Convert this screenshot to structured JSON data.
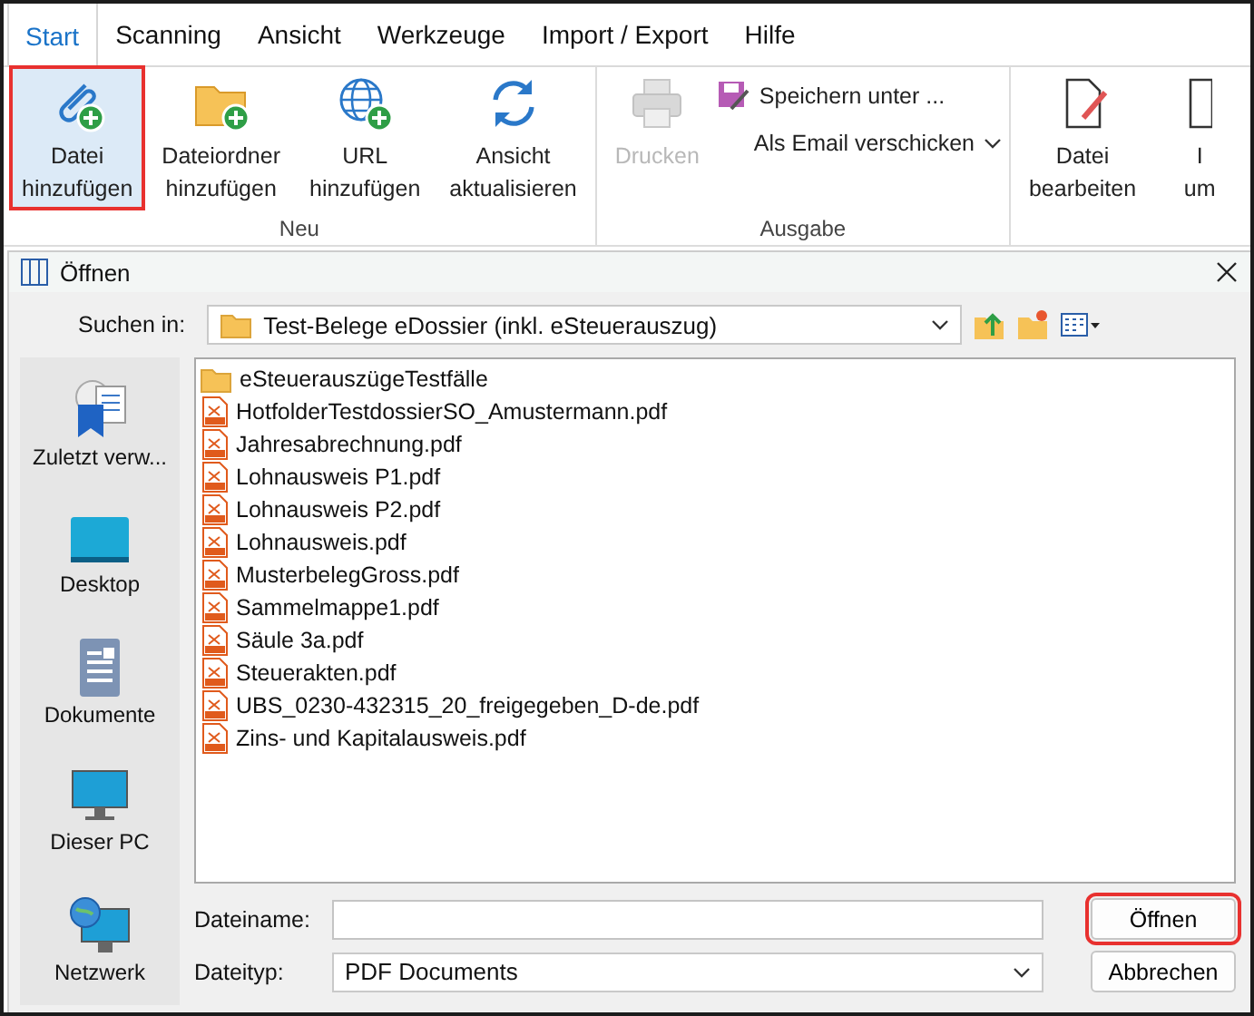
{
  "ribbon": {
    "tabs": [
      {
        "label": "Start",
        "selected": true
      },
      {
        "label": "Scanning",
        "selected": false
      },
      {
        "label": "Ansicht",
        "selected": false
      },
      {
        "label": "Werkzeuge",
        "selected": false
      },
      {
        "label": "Import / Export",
        "selected": false
      },
      {
        "label": "Hilfe",
        "selected": false
      }
    ],
    "groups": [
      {
        "label": "Neu",
        "buttons": [
          {
            "kind": "large",
            "label": "Datei hinzufügen",
            "disabled": false,
            "highlighted": true
          },
          {
            "kind": "large",
            "label": "Dateiordner hinzufügen",
            "disabled": false,
            "highlighted": false
          },
          {
            "kind": "large",
            "label": "URL hinzufügen",
            "disabled": false,
            "highlighted": false
          },
          {
            "kind": "large",
            "label": "Ansicht aktualisieren",
            "disabled": false,
            "highlighted": false
          }
        ]
      },
      {
        "label": "Ausgabe",
        "buttons": [
          {
            "kind": "large",
            "label": "Drucken",
            "disabled": true,
            "highlighted": false
          },
          {
            "kind": "small",
            "label": "Speichern unter ...",
            "disabled": false,
            "highlighted": false
          },
          {
            "kind": "dropdown",
            "label": "Als Email verschicken",
            "disabled": false,
            "highlighted": false
          }
        ]
      },
      {
        "buttons": [
          {
            "kind": "large",
            "label": "Datei bearbeiten",
            "disabled": false,
            "highlighted": false
          },
          {
            "kind": "large",
            "label": "I um",
            "disabled": false,
            "highlighted": false
          }
        ]
      }
    ]
  },
  "dialog": {
    "title": "Öffnen",
    "look_in": {
      "label": "Suchen in:",
      "value": "Test-Belege eDossier (inkl. eSteuerauszug)"
    },
    "places": [
      {
        "label": "Zuletzt verw..."
      },
      {
        "label": "Desktop"
      },
      {
        "label": "Dokumente"
      },
      {
        "label": "Dieser PC"
      },
      {
        "label": "Netzwerk"
      }
    ],
    "files": [
      {
        "kind": "folder",
        "name": "eSteuerauszügeTestfälle"
      },
      {
        "kind": "pdf",
        "name": "HotfolderTestdossierSO_Amustermann.pdf"
      },
      {
        "kind": "pdf",
        "name": "Jahresabrechnung.pdf"
      },
      {
        "kind": "pdf",
        "name": "Lohnausweis P1.pdf"
      },
      {
        "kind": "pdf",
        "name": "Lohnausweis P2.pdf"
      },
      {
        "kind": "pdf",
        "name": "Lohnausweis.pdf"
      },
      {
        "kind": "pdf",
        "name": "MusterbelegGross.pdf"
      },
      {
        "kind": "pdf",
        "name": "Sammelmappe1.pdf"
      },
      {
        "kind": "pdf",
        "name": "Säule 3a.pdf"
      },
      {
        "kind": "pdf",
        "name": "Steuerakten.pdf"
      },
      {
        "kind": "pdf",
        "name": "UBS_0230-432315_20_freigegeben_D-de.pdf"
      },
      {
        "kind": "pdf",
        "name": "Zins- und Kapitalausweis.pdf"
      }
    ],
    "filename": {
      "label": "Dateiname:"
    },
    "filetype": {
      "label": "Dateityp:",
      "value": "PDF Documents"
    },
    "buttons": [
      {
        "label": "Öffnen",
        "highlighted": true
      },
      {
        "label": "Abbrechen",
        "highlighted": false
      }
    ]
  }
}
